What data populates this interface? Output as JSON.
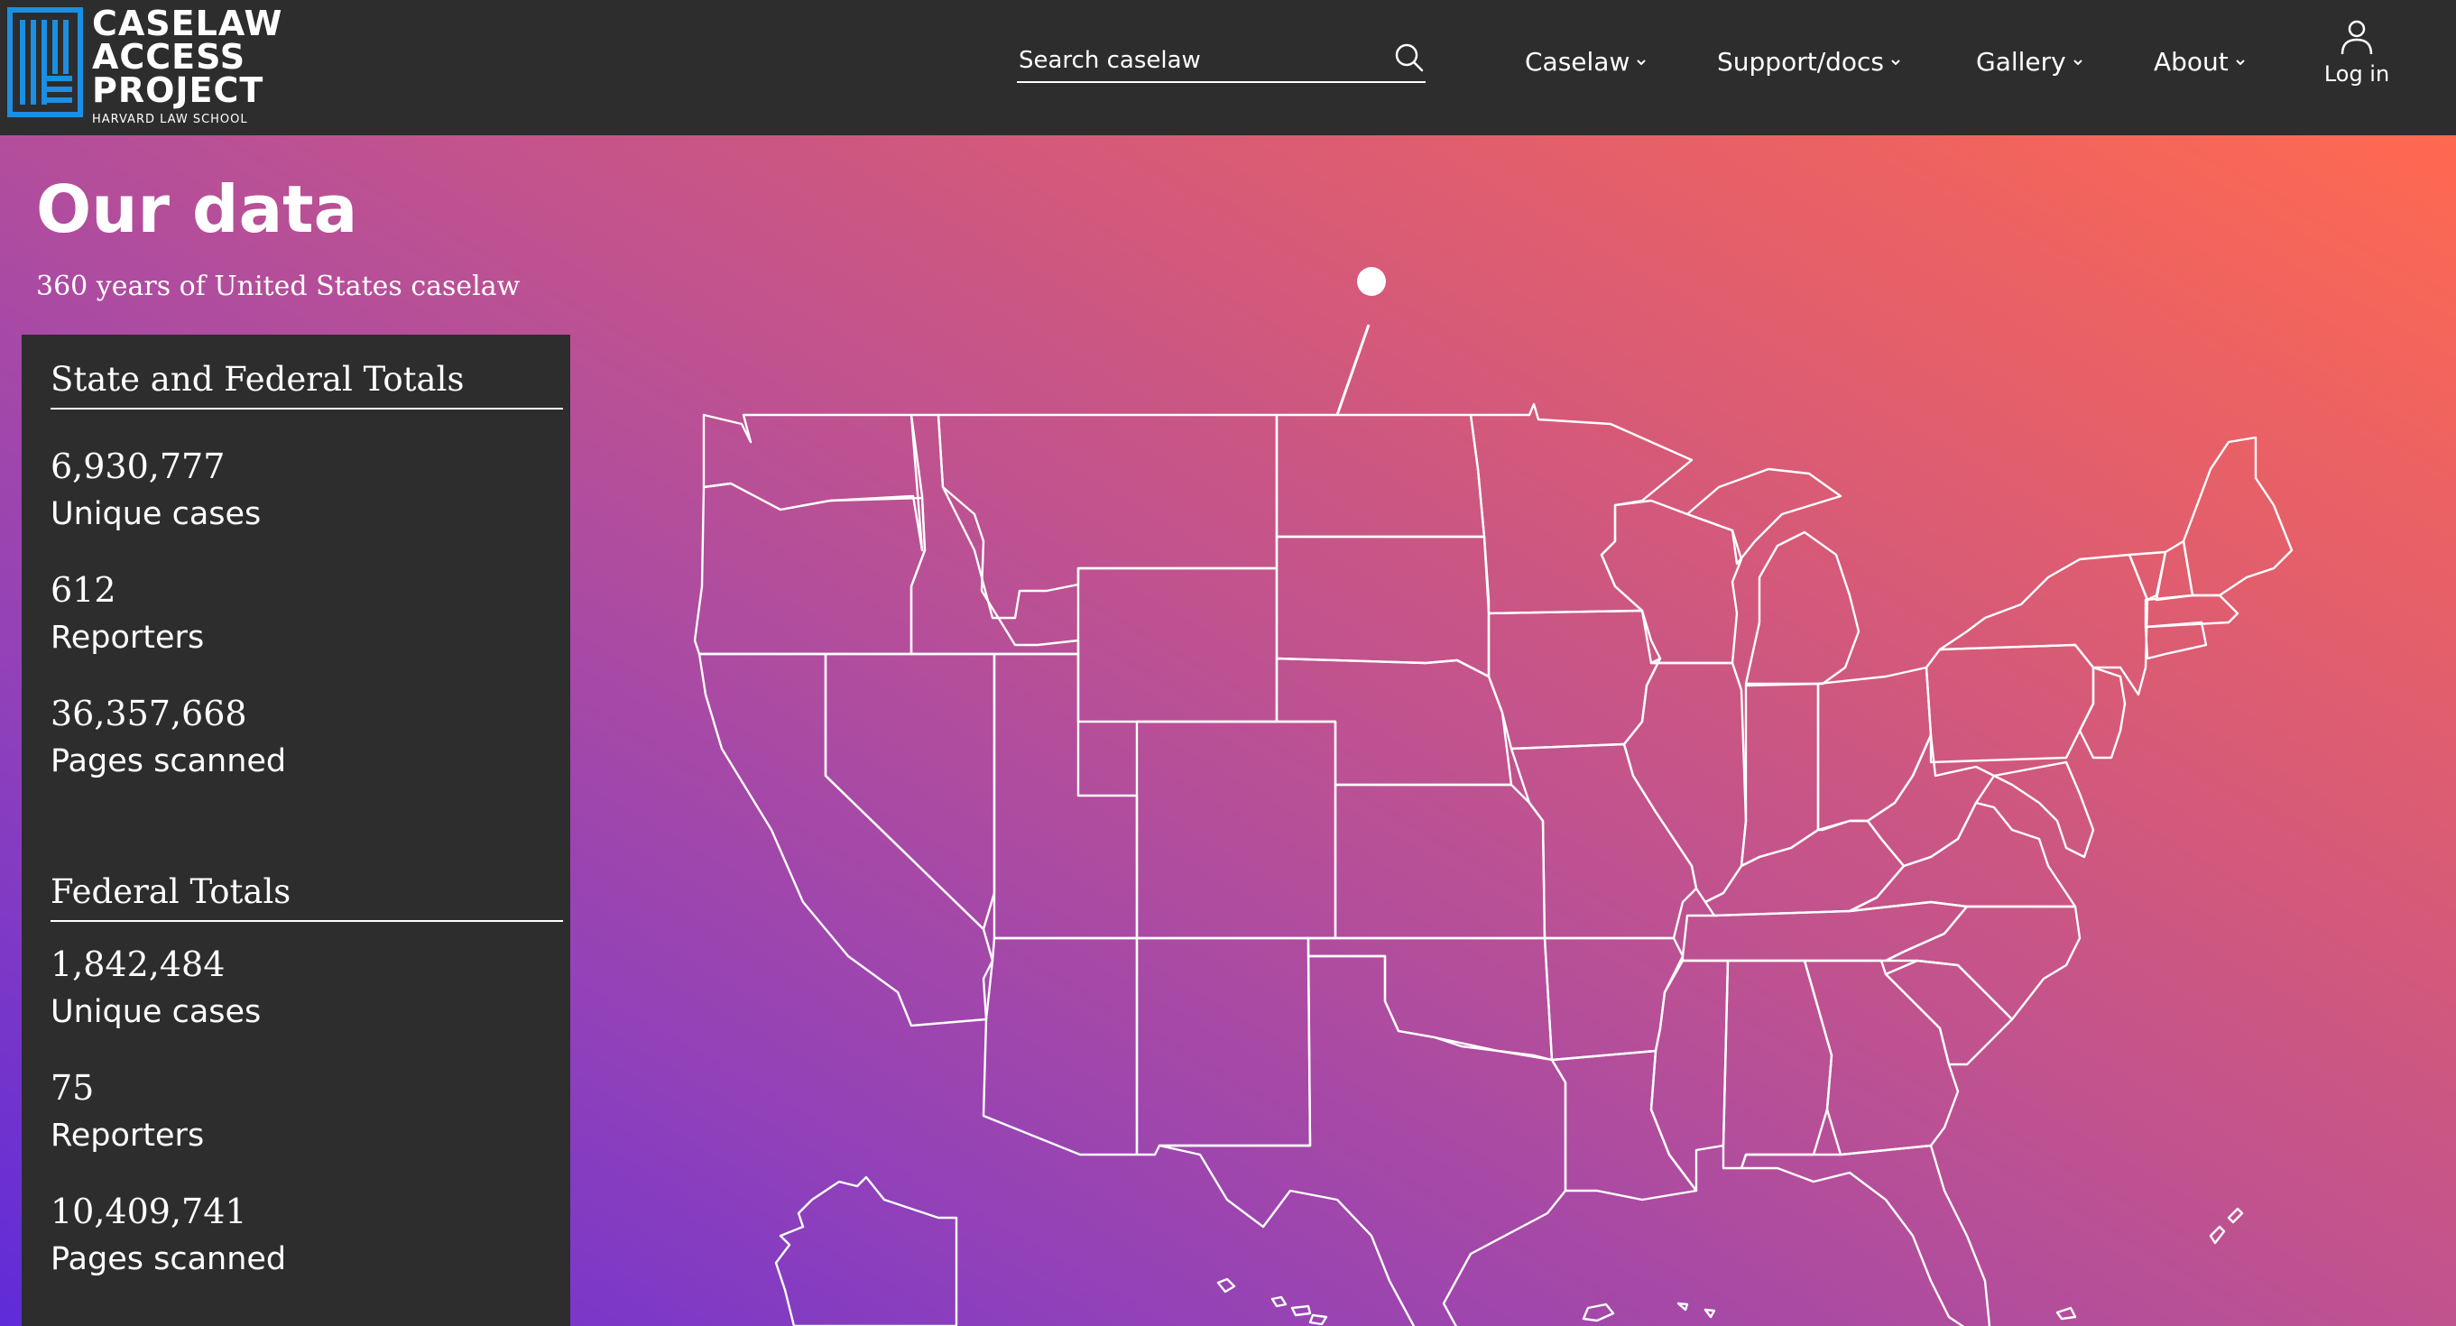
{
  "header": {
    "logo": {
      "line1": "CASELAW",
      "line2": "ACCESS",
      "line3": "PROJECT",
      "sub": "HARVARD LAW SCHOOL",
      "color": "#1a8fe3"
    },
    "search": {
      "placeholder": "Search caselaw",
      "icon": "search-icon"
    },
    "nav": [
      {
        "label": "Caselaw",
        "icon": "chevron-down-icon"
      },
      {
        "label": "Support/docs",
        "icon": "chevron-down-icon"
      },
      {
        "label": "Gallery",
        "icon": "chevron-down-icon"
      },
      {
        "label": "About",
        "icon": "chevron-down-icon"
      }
    ],
    "login": {
      "label": "Log in",
      "icon": "user-icon"
    }
  },
  "page": {
    "title": "Our data",
    "subtitle": "360 years of United States caselaw"
  },
  "stats": {
    "state_federal": {
      "heading": "State and Federal Totals",
      "items": [
        {
          "value": "6,930,777",
          "label": "Unique cases"
        },
        {
          "value": "612",
          "label": "Reporters"
        },
        {
          "value": "36,357,668",
          "label": "Pages scanned"
        }
      ]
    },
    "federal": {
      "heading": "Federal Totals",
      "items": [
        {
          "value": "1,842,484",
          "label": "Unique cases"
        },
        {
          "value": "75",
          "label": "Reporters"
        },
        {
          "value": "10,409,741",
          "label": "Pages scanned"
        }
      ]
    }
  },
  "colors": {
    "header_bg": "#2d2d2d",
    "gradient_start": "#5f2bd8",
    "gradient_mid": "#b74f98",
    "gradient_end": "#ff6950",
    "panel_bg": "#2d2d2d"
  }
}
